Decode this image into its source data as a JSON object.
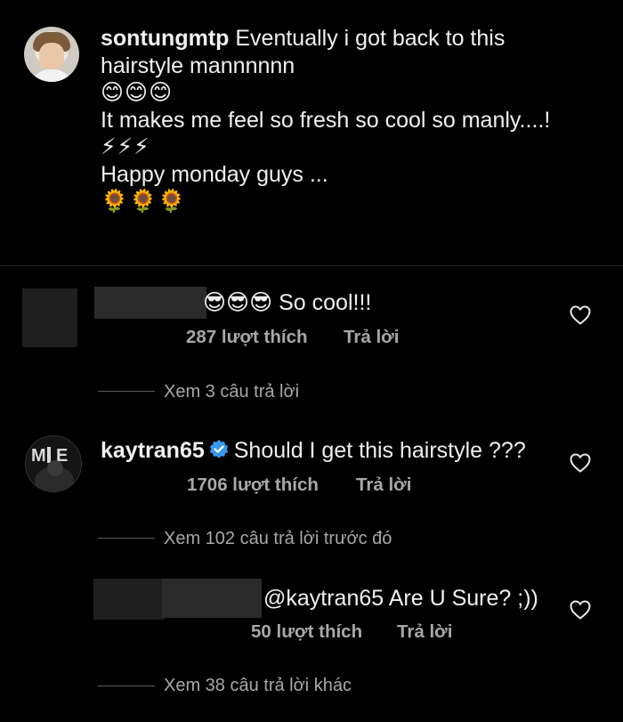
{
  "caption": {
    "username": "sontungmtp",
    "line1_rest": "Eventually i got back to this",
    "line2": "hairstyle mannnnnn",
    "emoji1": "😊😊😊",
    "line3": "It makes me feel so fresh so cool so manly....!",
    "emoji2": "⚡⚡⚡",
    "line4": "Happy monday guys ...",
    "emoji3": "🌻🌻🌻"
  },
  "comment1": {
    "text": "😎😎😎 So cool!!!",
    "likes": "287 lượt thích",
    "reply": "Trả lời",
    "view_replies": "Xem 3 câu trả lời"
  },
  "comment2": {
    "username": "kaytran65",
    "text": "Should I get this hairstyle ???",
    "likes": "1706 lượt thích",
    "reply": "Trả lời",
    "view_replies": "Xem 102 câu trả lời trước đó"
  },
  "reply1": {
    "text": "@kaytran65 Are U Sure? ;))",
    "likes": "50 lượt thích",
    "reply": "Trả lời",
    "view_replies": "Xem 38 câu trả lời khác"
  },
  "icons": {
    "heart": "heart-outline-icon",
    "verified": "verified-badge-icon"
  },
  "colors": {
    "background": "#000000",
    "text": "#f0f0f0",
    "secondary_text": "#a8a8a8",
    "verified": "#3897f0"
  }
}
